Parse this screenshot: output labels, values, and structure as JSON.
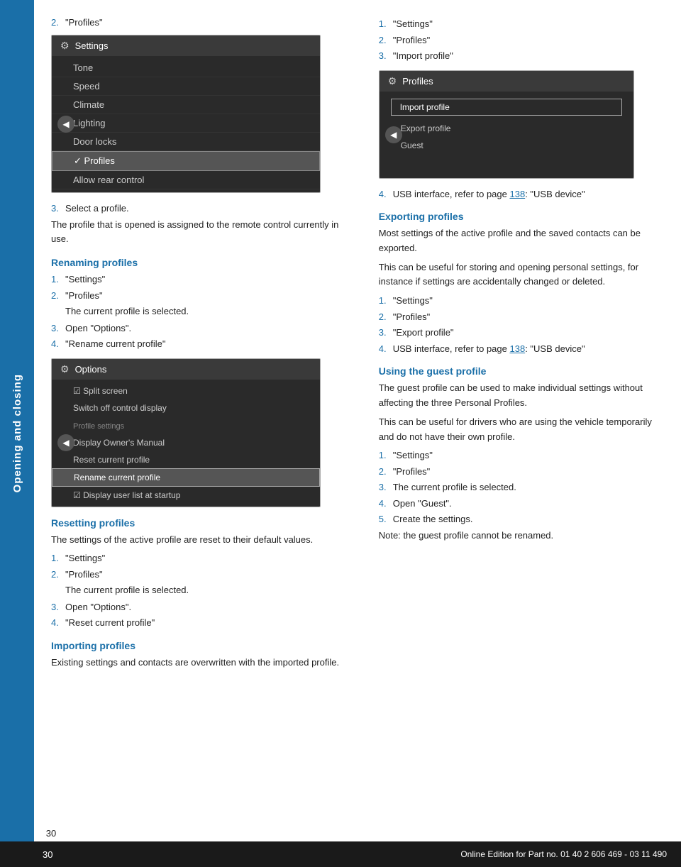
{
  "sidebar": {
    "label": "Opening and closing"
  },
  "page": {
    "number": "30"
  },
  "footer": {
    "text": "Online Edition for Part no. 01 40 2 606 469 - 03 11 490"
  },
  "left_column": {
    "top_step": {
      "num": "2.",
      "text": "\"Profiles\""
    },
    "settings_screenshot": {
      "header": "Settings",
      "items": [
        "Tone",
        "Speed",
        "Climate",
        "Lighting",
        "Door locks",
        "Profiles",
        "Allow rear control"
      ],
      "selected": "Profiles"
    },
    "step3": "Select a profile.",
    "para1": "The profile that is opened is assigned to the remote control currently in use.",
    "renaming_profiles": {
      "heading": "Renaming profiles",
      "steps": [
        {
          "num": "1.",
          "text": "\"Settings\""
        },
        {
          "num": "2.",
          "text": "\"Profiles\""
        },
        {
          "num": "3.",
          "text": "Open \"Options\"."
        },
        {
          "num": "4.",
          "text": "\"Rename current profile\""
        }
      ],
      "sub2": "The current profile is selected."
    },
    "options_screenshot": {
      "header": "Options",
      "items": [
        {
          "text": "Split screen",
          "type": "checkbox"
        },
        {
          "text": "Switch off control display",
          "type": "normal"
        },
        {
          "text": "Profile settings",
          "type": "section"
        },
        {
          "text": "Display Owner's Manual",
          "type": "normal"
        },
        {
          "text": "Reset current profile",
          "type": "normal"
        },
        {
          "text": "Rename current profile",
          "type": "highlighted"
        },
        {
          "text": "Display user list at startup",
          "type": "checkbox"
        }
      ]
    },
    "resetting_profiles": {
      "heading": "Resetting profiles",
      "para": "The settings of the active profile are reset to their default values.",
      "steps": [
        {
          "num": "1.",
          "text": "\"Settings\""
        },
        {
          "num": "2.",
          "text": "\"Profiles\""
        },
        {
          "num": "3.",
          "text": "Open \"Options\"."
        },
        {
          "num": "4.",
          "text": "\"Reset current profile\""
        }
      ],
      "sub2": "The current profile is selected."
    },
    "importing_profiles": {
      "heading": "Importing profiles",
      "para": "Existing settings and contacts are overwritten with the imported profile."
    }
  },
  "right_column": {
    "importing_steps": [
      {
        "num": "1.",
        "text": "\"Settings\""
      },
      {
        "num": "2.",
        "text": "\"Profiles\""
      },
      {
        "num": "3.",
        "text": "\"Import profile\""
      }
    ],
    "import_screenshot": {
      "header": "Profiles",
      "items": [
        {
          "text": "Import profile",
          "type": "highlighted"
        },
        {
          "text": "Export profile",
          "type": "normal"
        },
        {
          "text": "Guest",
          "type": "normal"
        }
      ]
    },
    "step4": "USB interface, refer to page ",
    "step4_link": "138",
    "step4_end": ": \"USB device\"",
    "exporting_profiles": {
      "heading": "Exporting profiles",
      "para1": "Most settings of the active profile and the saved contacts can be exported.",
      "para2": "This can be useful for storing and opening personal settings, for instance if settings are accidentally changed or deleted.",
      "steps": [
        {
          "num": "1.",
          "text": "\"Settings\""
        },
        {
          "num": "2.",
          "text": "\"Profiles\""
        },
        {
          "num": "3.",
          "text": "\"Export profile\""
        }
      ],
      "step4": "USB interface, refer to page ",
      "step4_link": "138",
      "step4_end": ": \"USB device\""
    },
    "using_guest_profile": {
      "heading": "Using the guest profile",
      "para1": "The guest profile can be used to make individual settings without affecting the three Personal Profiles.",
      "para2": "This can be useful for drivers who are using the vehicle temporarily and do not have their own profile.",
      "steps": [
        {
          "num": "1.",
          "text": "\"Settings\""
        },
        {
          "num": "2.",
          "text": "\"Profiles\""
        },
        {
          "num": "3.",
          "text": "The current profile is selected."
        },
        {
          "num": "4.",
          "text": "Open \"Guest\"."
        },
        {
          "num": "5.",
          "text": "Create the settings."
        }
      ],
      "note": "Note: the guest profile cannot be renamed."
    }
  }
}
